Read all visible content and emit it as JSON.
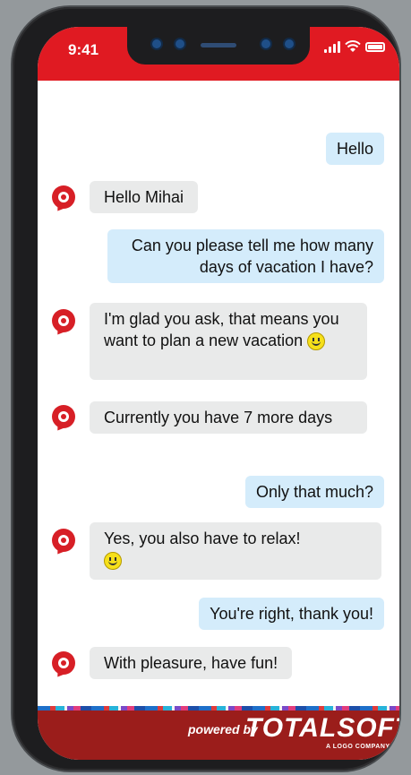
{
  "status": {
    "time": "9:41"
  },
  "messages": {
    "m1": "Hello",
    "m2": "Hello Mihai",
    "m3": "Can you please tell me how many days of vacation I have?",
    "m4": "I'm glad you ask, that means you want to plan a new vacation",
    "m5": "Currently you have 7 more days",
    "m6": "Only that much?",
    "m7": "Yes, you also have to relax!",
    "m8": "You're right, thank you!",
    "m9": "With pleasure, have fun!"
  },
  "footer": {
    "powered": "powered by",
    "brand": "TOTALSOFT",
    "brand_sub": "A LOGO COMPANY"
  },
  "colors": {
    "accent": "#e01a22",
    "user_bubble": "#d4ecfb",
    "bot_bubble": "#e9eaea",
    "footer": "#9b1d1b"
  }
}
